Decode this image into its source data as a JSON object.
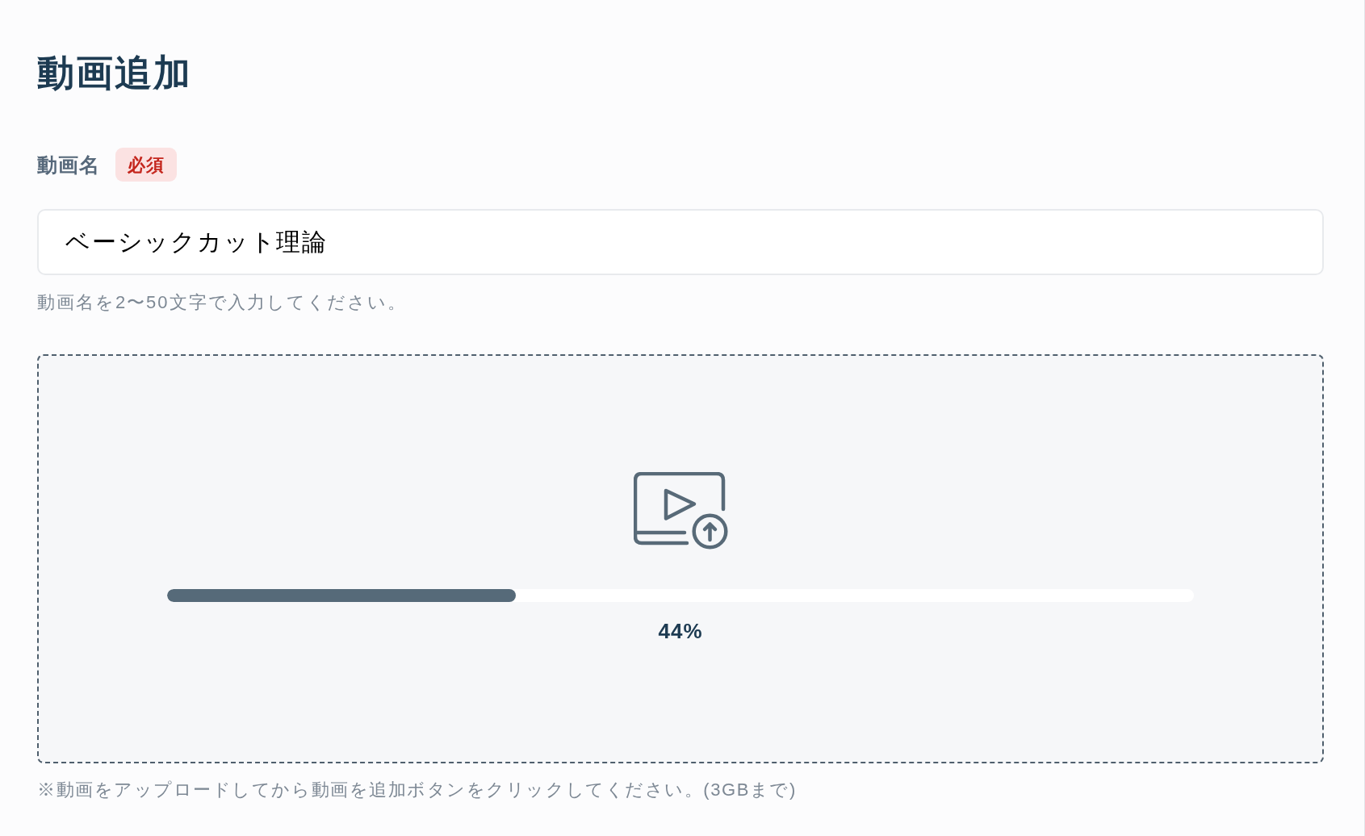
{
  "page": {
    "title": "動画追加"
  },
  "field": {
    "label": "動画名",
    "badge": "必須",
    "value": "ベーシックカット理論",
    "hint": "動画名を2〜50文字で入力してください。"
  },
  "upload": {
    "level": 0.34,
    "reading": "44%",
    "note": "※動画をアップロードしてから動画を追加ボタンをクリックしてください。(3GBまで)"
  }
}
